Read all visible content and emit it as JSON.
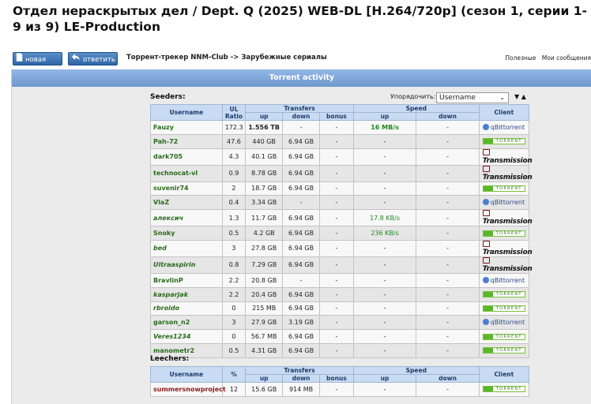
{
  "title": "Отдел нераскрытых дел / Dept. Q (2025) WEB-DL [H.264/720p] (сезон 1, серии 1-9 из 9) LE-Production",
  "toolbar": {
    "new_topic": "новая тема",
    "reply": "ответить",
    "breadcrumb": "Торрент-трекер NNM-Club -> Зарубежные сериалы",
    "links": [
      "Полезные",
      "Мои сообщения"
    ]
  },
  "panel": {
    "title": "Torrent activity",
    "sort_label": "Упорядочить:",
    "sort_value": "Username",
    "sort_arrows": "▼ ▲"
  },
  "seeders": {
    "label": "Seeders:",
    "headers": {
      "username": "Username",
      "ul_ratio": "UL Ratio",
      "transfers": "Transfers",
      "speed": "Speed",
      "client": "Client",
      "up": "up",
      "down": "down",
      "bonus": "bonus",
      "sp_up": "up",
      "sp_down": "down"
    },
    "rows": [
      {
        "user": "Fauzy",
        "ratio": "172.3",
        "up": "1.556 TB",
        "down": "-",
        "bonus": "-",
        "sup": "16 MB/s",
        "sdown": "-",
        "client": "qbittorrent",
        "up_style": "up-bold",
        "sup_style": "green-bold",
        "italic": false
      },
      {
        "user": "Pah-72",
        "ratio": "47.6",
        "up": "440 GB",
        "down": "6.94 GB",
        "bonus": "-",
        "sup": "-",
        "sdown": "-",
        "client": "utorrent",
        "italic": false
      },
      {
        "user": "dark705",
        "ratio": "4.3",
        "up": "40.1 GB",
        "down": "6.94 GB",
        "bonus": "-",
        "sup": "-",
        "sdown": "-",
        "client": "transmission",
        "italic": false
      },
      {
        "user": "technocat-vl",
        "ratio": "0.9",
        "up": "8.78 GB",
        "down": "6.94 GB",
        "bonus": "-",
        "sup": "-",
        "sdown": "-",
        "client": "transmission",
        "italic": false
      },
      {
        "user": "suvenir74",
        "ratio": "2",
        "up": "18.7 GB",
        "down": "6.94 GB",
        "bonus": "-",
        "sup": "-",
        "sdown": "-",
        "client": "utorrent",
        "italic": false
      },
      {
        "user": "VlaZ",
        "ratio": "0.4",
        "up": "3.34 GB",
        "down": "-",
        "bonus": "-",
        "sup": "-",
        "sdown": "-",
        "client": "qbittorrent",
        "italic": false
      },
      {
        "user": "алексич",
        "ratio": "1.3",
        "up": "11.7 GB",
        "down": "6.94 GB",
        "bonus": "-",
        "sup": "17.8 KB/s",
        "sdown": "-",
        "client": "transmission",
        "sup_style": "green",
        "italic": true
      },
      {
        "user": "Snoky",
        "ratio": "0.5",
        "up": "4.2 GB",
        "down": "6.94 GB",
        "bonus": "-",
        "sup": "236 KB/s",
        "sdown": "-",
        "client": "utorrent",
        "sup_style": "green",
        "italic": false
      },
      {
        "user": "bed",
        "ratio": "3",
        "up": "27.8 GB",
        "down": "6.94 GB",
        "bonus": "-",
        "sup": "-",
        "sdown": "-",
        "client": "transmission",
        "italic": true
      },
      {
        "user": "Ultraaspirin",
        "ratio": "0.8",
        "up": "7.29 GB",
        "down": "6.94 GB",
        "bonus": "-",
        "sup": "-",
        "sdown": "-",
        "client": "transmission",
        "italic": true
      },
      {
        "user": "BravlinP",
        "ratio": "2.2",
        "up": "20.8 GB",
        "down": "-",
        "bonus": "-",
        "sup": "-",
        "sdown": "-",
        "client": "qbittorrent",
        "italic": false
      },
      {
        "user": "kasparjak",
        "ratio": "2.2",
        "up": "20.4 GB",
        "down": "6.94 GB",
        "bonus": "-",
        "sup": "-",
        "sdown": "-",
        "client": "utorrent",
        "italic": true
      },
      {
        "user": "rbroido",
        "ratio": "0",
        "up": "215 MB",
        "down": "6.94 GB",
        "bonus": "-",
        "sup": "-",
        "sdown": "-",
        "client": "utorrent",
        "italic": true
      },
      {
        "user": "garson_n2",
        "ratio": "3",
        "up": "27.9 GB",
        "down": "3.19 GB",
        "bonus": "-",
        "sup": "-",
        "sdown": "-",
        "client": "qbittorrent",
        "italic": false
      },
      {
        "user": "Veres1234",
        "ratio": "0",
        "up": "56.7 MB",
        "down": "6.94 GB",
        "bonus": "-",
        "sup": "-",
        "sdown": "-",
        "client": "utorrent",
        "italic": true
      },
      {
        "user": "manometr2",
        "ratio": "0.5",
        "up": "4.31 GB",
        "down": "6.94 GB",
        "bonus": "-",
        "sup": "-",
        "sdown": "-",
        "client": "utorrent",
        "italic": false
      }
    ]
  },
  "leechers": {
    "label": "Leechers:",
    "headers": {
      "username": "Username",
      "percent": "%",
      "transfers": "Transfers",
      "speed": "Speed",
      "client": "Client",
      "up": "up",
      "down": "down",
      "bonus": "bonus",
      "sp_up": "up",
      "sp_down": "down"
    },
    "rows": [
      {
        "user": "summersnowproject",
        "pct": "12",
        "up": "15.6 GB",
        "down": "914 MB",
        "bonus": "-",
        "sup": "-",
        "sdown": "-",
        "client": "utorrent"
      }
    ]
  },
  "client_labels": {
    "qbittorrent": "qBittorrent",
    "transmission": "Transmission",
    "utorrent": "TORRENT"
  }
}
